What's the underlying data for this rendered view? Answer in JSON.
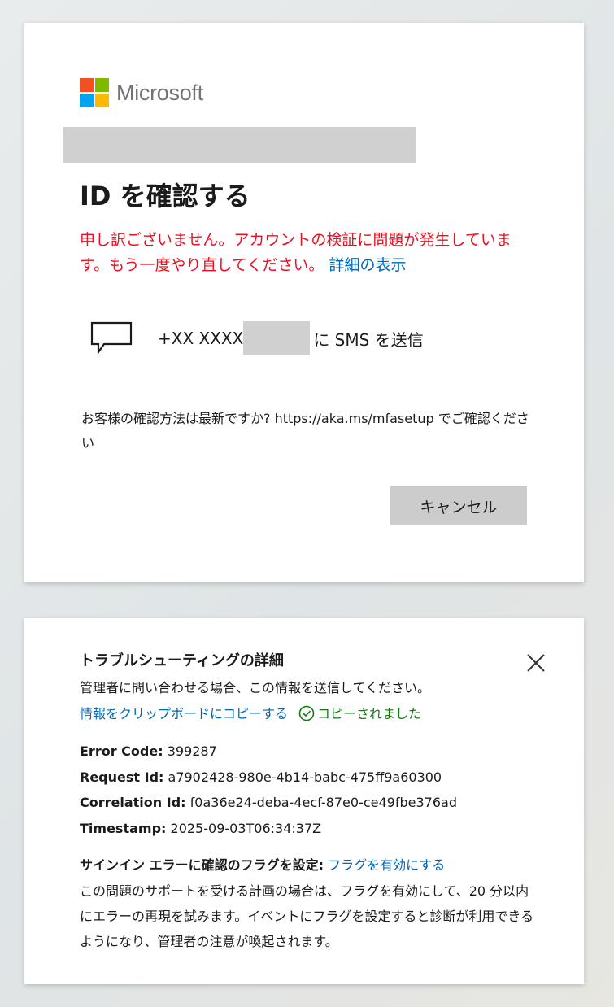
{
  "colors": {
    "error": "#e81123",
    "link": "#0067b8",
    "success": "#107c10",
    "button_bg": "#cccccc"
  },
  "brand": {
    "name": "Microsoft"
  },
  "verify": {
    "title": "ID を確認する",
    "error_message": "申し訳ございません。アカウントの検証に問題が発生しています。もう一度やり直してください。",
    "details_link": "詳細の表示",
    "sms_prefix": "+XX XXXX",
    "sms_suffix": "に SMS を送信",
    "hint": "お客様の確認方法は最新ですか? https://aka.ms/mfasetup でご確認ください",
    "cancel_label": "キャンセル"
  },
  "troubleshooting": {
    "title": "トラブルシューティングの詳細",
    "description": "管理者に問い合わせる場合、この情報を送信してください。",
    "copy_link": "情報をクリップボードにコピーする",
    "copied_status": "コピーされました",
    "details": [
      {
        "key": "Error Code:",
        "value": "399287"
      },
      {
        "key": "Request Id:",
        "value": "a7902428-980e-4b14-babc-475ff9a60300"
      },
      {
        "key": "Correlation Id:",
        "value": "f0a36e24-deba-4ecf-87e0-ce49fbe376ad"
      },
      {
        "key": "Timestamp:",
        "value": "2025-09-03T06:34:37Z"
      }
    ],
    "flag_label": "サインイン エラーに確認のフラグを設定:",
    "flag_link": "フラグを有効にする",
    "flag_description": "この問題のサポートを受ける計画の場合は、フラグを有効にして、20 分以内にエラーの再現を試みます。イベントにフラグを設定すると診断が利用できるようになり、管理者の注意が喚起されます。"
  }
}
